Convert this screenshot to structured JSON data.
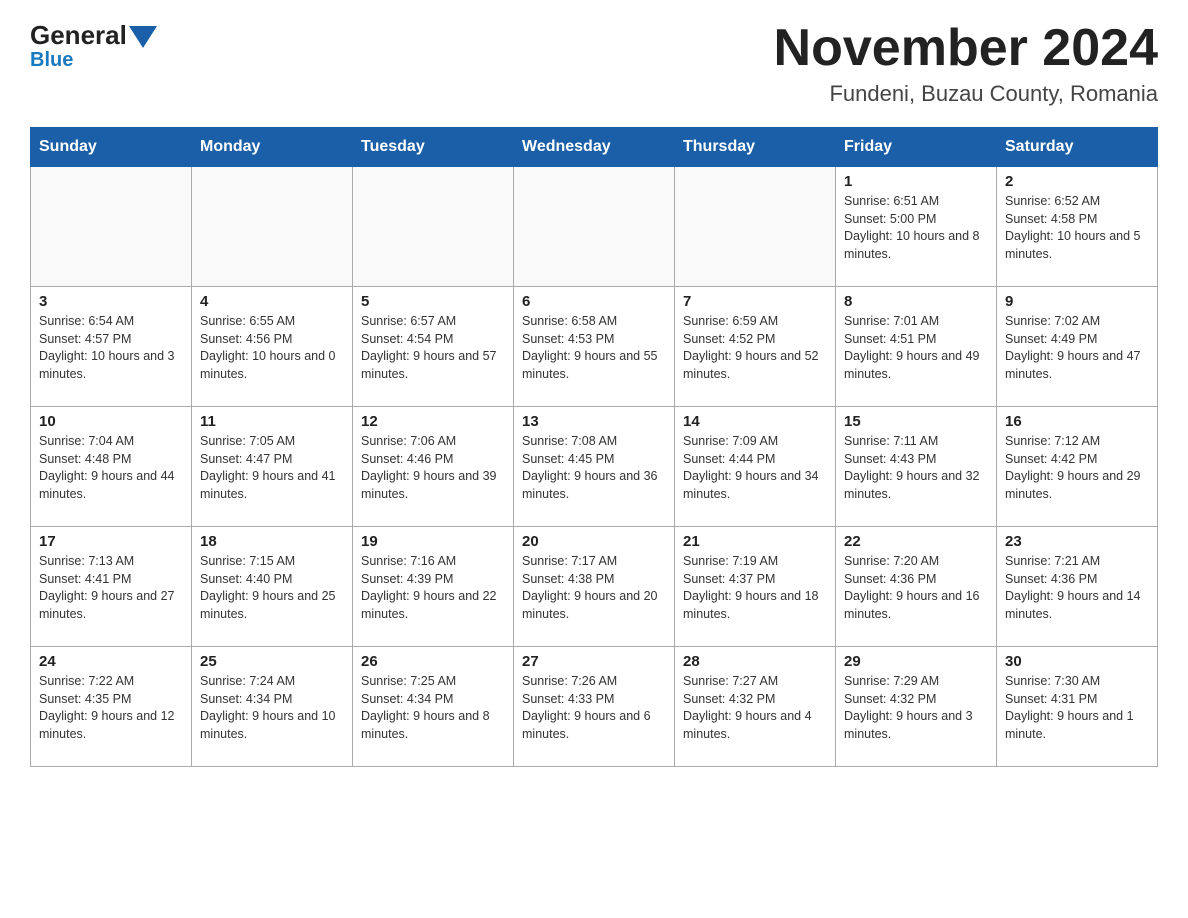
{
  "header": {
    "logo_general": "General",
    "logo_blue": "Blue",
    "month_title": "November 2024",
    "location": "Fundeni, Buzau County, Romania"
  },
  "calendar": {
    "days_of_week": [
      "Sunday",
      "Monday",
      "Tuesday",
      "Wednesday",
      "Thursday",
      "Friday",
      "Saturday"
    ],
    "weeks": [
      [
        {
          "day": "",
          "info": ""
        },
        {
          "day": "",
          "info": ""
        },
        {
          "day": "",
          "info": ""
        },
        {
          "day": "",
          "info": ""
        },
        {
          "day": "",
          "info": ""
        },
        {
          "day": "1",
          "info": "Sunrise: 6:51 AM\nSunset: 5:00 PM\nDaylight: 10 hours and 8 minutes."
        },
        {
          "day": "2",
          "info": "Sunrise: 6:52 AM\nSunset: 4:58 PM\nDaylight: 10 hours and 5 minutes."
        }
      ],
      [
        {
          "day": "3",
          "info": "Sunrise: 6:54 AM\nSunset: 4:57 PM\nDaylight: 10 hours and 3 minutes."
        },
        {
          "day": "4",
          "info": "Sunrise: 6:55 AM\nSunset: 4:56 PM\nDaylight: 10 hours and 0 minutes."
        },
        {
          "day": "5",
          "info": "Sunrise: 6:57 AM\nSunset: 4:54 PM\nDaylight: 9 hours and 57 minutes."
        },
        {
          "day": "6",
          "info": "Sunrise: 6:58 AM\nSunset: 4:53 PM\nDaylight: 9 hours and 55 minutes."
        },
        {
          "day": "7",
          "info": "Sunrise: 6:59 AM\nSunset: 4:52 PM\nDaylight: 9 hours and 52 minutes."
        },
        {
          "day": "8",
          "info": "Sunrise: 7:01 AM\nSunset: 4:51 PM\nDaylight: 9 hours and 49 minutes."
        },
        {
          "day": "9",
          "info": "Sunrise: 7:02 AM\nSunset: 4:49 PM\nDaylight: 9 hours and 47 minutes."
        }
      ],
      [
        {
          "day": "10",
          "info": "Sunrise: 7:04 AM\nSunset: 4:48 PM\nDaylight: 9 hours and 44 minutes."
        },
        {
          "day": "11",
          "info": "Sunrise: 7:05 AM\nSunset: 4:47 PM\nDaylight: 9 hours and 41 minutes."
        },
        {
          "day": "12",
          "info": "Sunrise: 7:06 AM\nSunset: 4:46 PM\nDaylight: 9 hours and 39 minutes."
        },
        {
          "day": "13",
          "info": "Sunrise: 7:08 AM\nSunset: 4:45 PM\nDaylight: 9 hours and 36 minutes."
        },
        {
          "day": "14",
          "info": "Sunrise: 7:09 AM\nSunset: 4:44 PM\nDaylight: 9 hours and 34 minutes."
        },
        {
          "day": "15",
          "info": "Sunrise: 7:11 AM\nSunset: 4:43 PM\nDaylight: 9 hours and 32 minutes."
        },
        {
          "day": "16",
          "info": "Sunrise: 7:12 AM\nSunset: 4:42 PM\nDaylight: 9 hours and 29 minutes."
        }
      ],
      [
        {
          "day": "17",
          "info": "Sunrise: 7:13 AM\nSunset: 4:41 PM\nDaylight: 9 hours and 27 minutes."
        },
        {
          "day": "18",
          "info": "Sunrise: 7:15 AM\nSunset: 4:40 PM\nDaylight: 9 hours and 25 minutes."
        },
        {
          "day": "19",
          "info": "Sunrise: 7:16 AM\nSunset: 4:39 PM\nDaylight: 9 hours and 22 minutes."
        },
        {
          "day": "20",
          "info": "Sunrise: 7:17 AM\nSunset: 4:38 PM\nDaylight: 9 hours and 20 minutes."
        },
        {
          "day": "21",
          "info": "Sunrise: 7:19 AM\nSunset: 4:37 PM\nDaylight: 9 hours and 18 minutes."
        },
        {
          "day": "22",
          "info": "Sunrise: 7:20 AM\nSunset: 4:36 PM\nDaylight: 9 hours and 16 minutes."
        },
        {
          "day": "23",
          "info": "Sunrise: 7:21 AM\nSunset: 4:36 PM\nDaylight: 9 hours and 14 minutes."
        }
      ],
      [
        {
          "day": "24",
          "info": "Sunrise: 7:22 AM\nSunset: 4:35 PM\nDaylight: 9 hours and 12 minutes."
        },
        {
          "day": "25",
          "info": "Sunrise: 7:24 AM\nSunset: 4:34 PM\nDaylight: 9 hours and 10 minutes."
        },
        {
          "day": "26",
          "info": "Sunrise: 7:25 AM\nSunset: 4:34 PM\nDaylight: 9 hours and 8 minutes."
        },
        {
          "day": "27",
          "info": "Sunrise: 7:26 AM\nSunset: 4:33 PM\nDaylight: 9 hours and 6 minutes."
        },
        {
          "day": "28",
          "info": "Sunrise: 7:27 AM\nSunset: 4:32 PM\nDaylight: 9 hours and 4 minutes."
        },
        {
          "day": "29",
          "info": "Sunrise: 7:29 AM\nSunset: 4:32 PM\nDaylight: 9 hours and 3 minutes."
        },
        {
          "day": "30",
          "info": "Sunrise: 7:30 AM\nSunset: 4:31 PM\nDaylight: 9 hours and 1 minute."
        }
      ]
    ]
  }
}
